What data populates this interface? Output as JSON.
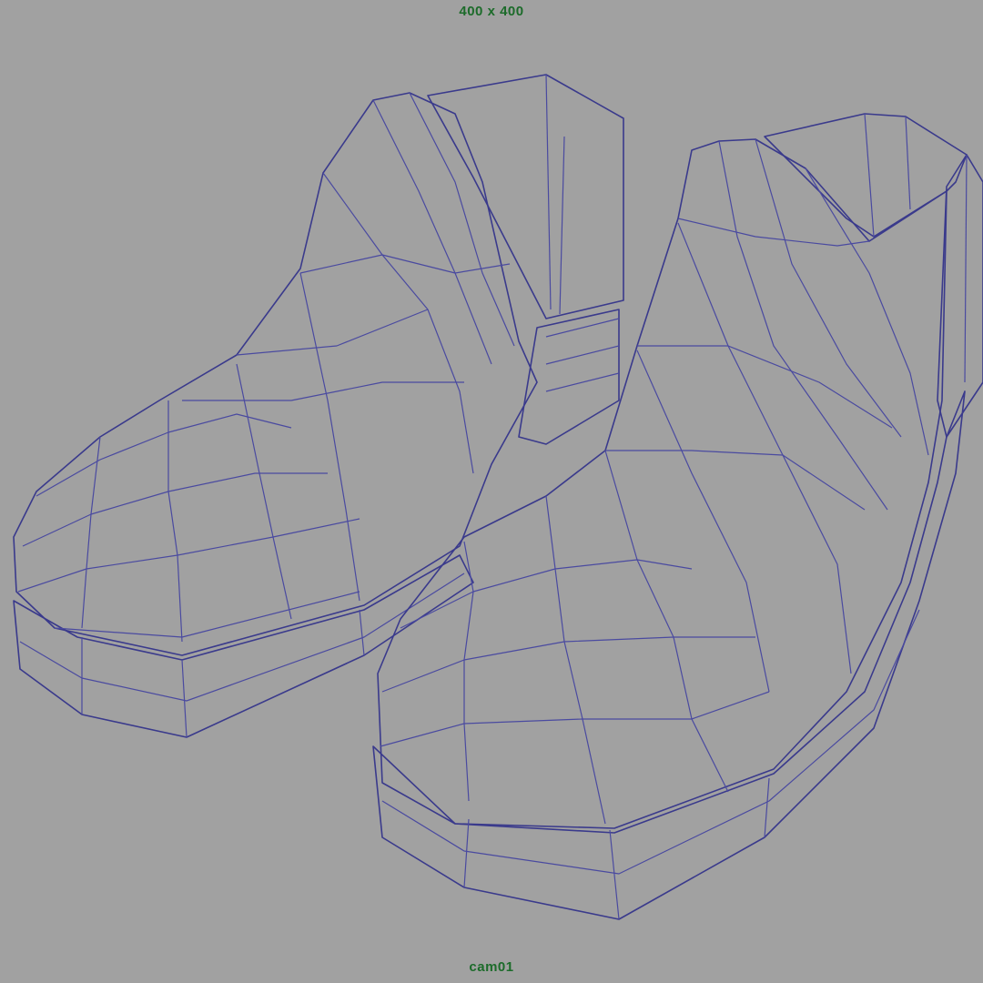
{
  "viewport": {
    "resolution_label": "400 x 400",
    "camera_label": "cam01"
  },
  "scene": {
    "objects": [
      "left-boot",
      "right-boot"
    ],
    "wireframe_color": "#3a3a8c",
    "background_color": "#a1a1a1",
    "surface_color": "#e6e6e6",
    "hud_text_color": "#1c6b2a"
  }
}
